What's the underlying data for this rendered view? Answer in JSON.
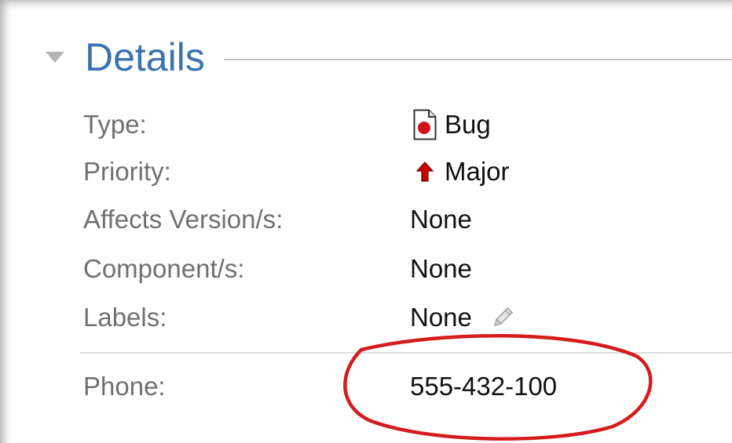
{
  "details": {
    "title": "Details",
    "toggle_icon": "triangle-down-icon",
    "fields": {
      "type": {
        "label": "Type:",
        "value": "Bug",
        "icon": "bug-icon",
        "icon_color": "#d0101a"
      },
      "priority": {
        "label": "Priority:",
        "value": "Major",
        "icon": "arrow-up-icon",
        "icon_color": "#cc0000"
      },
      "affects_version": {
        "label": "Affects Version/s:",
        "value": "None"
      },
      "component": {
        "label": "Component/s:",
        "value": "None"
      },
      "labels": {
        "label": "Labels:",
        "value": "None",
        "edit_icon": "pencil-icon"
      },
      "phone": {
        "label": "Phone:",
        "value": "555-432-100"
      }
    }
  },
  "colors": {
    "title": "#3b73af",
    "label": "#707070",
    "value": "#111111",
    "annotation": "#d41c1c"
  }
}
